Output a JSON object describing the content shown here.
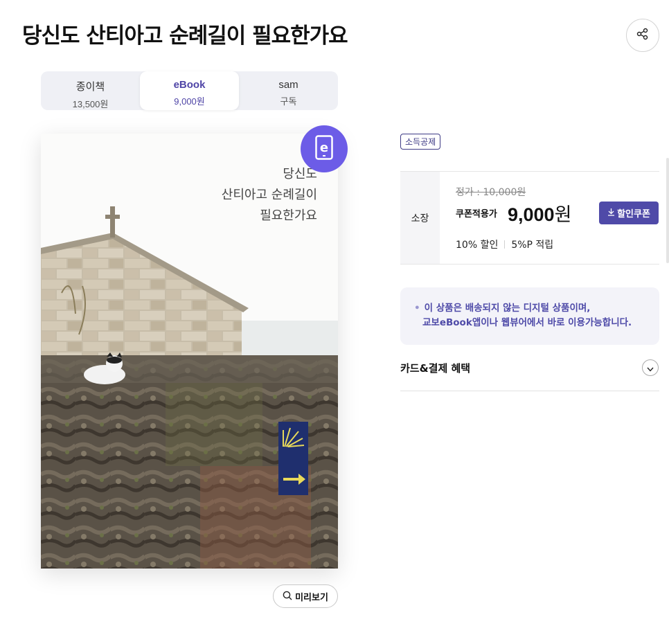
{
  "product": {
    "title": "당신도 산티아고 순례길이 필요한가요"
  },
  "format_tabs": [
    {
      "name": "종이책",
      "price": "13,500원"
    },
    {
      "name": "eBook",
      "price": "9,000원"
    },
    {
      "name": "sam",
      "price": "구독"
    }
  ],
  "cover": {
    "text_line1": "당신도",
    "text_line2": "산티아고 순례길이",
    "text_line3": "필요한가요"
  },
  "badges": {
    "ebook_letter": "e",
    "tax": "소득공제"
  },
  "price": {
    "label": "소장",
    "list_price": "정가 : 10,000원",
    "coupon_label": "쿠폰적용가",
    "sale_amount": "9,000",
    "sale_unit": "원",
    "coupon_button": "할인쿠폰",
    "discount": "10% 할인",
    "points": "5%P 적립"
  },
  "notice": {
    "line1": "이 상품은 배송되지 않는 디지털 상품이며,",
    "line2": "교보eBook앱이나 웹뷰어에서 바로 이용가능합니다."
  },
  "card_benefit": {
    "title": "카드&결제 혜택"
  },
  "preview": {
    "label": "미리보기"
  },
  "colors": {
    "accent": "#4f4aa8",
    "badge": "#6c5ce7"
  }
}
